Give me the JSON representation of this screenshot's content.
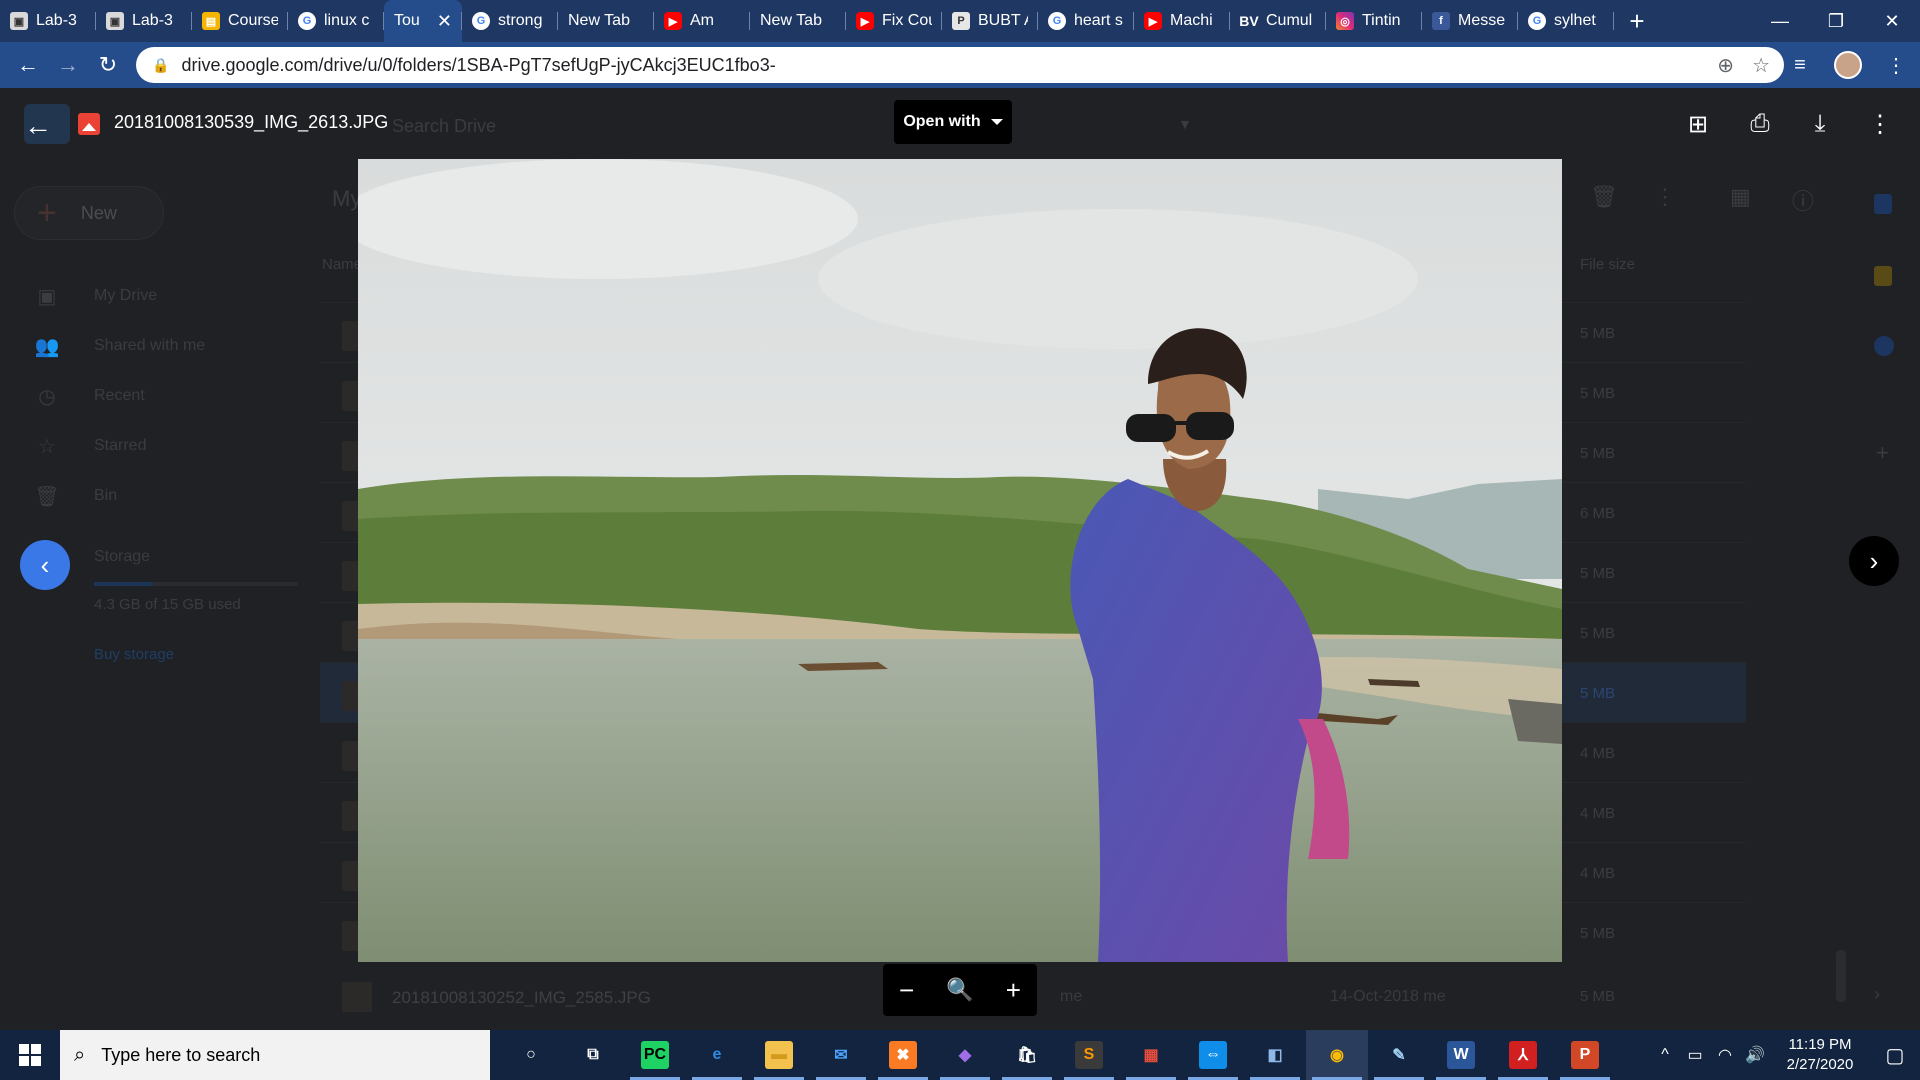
{
  "browser": {
    "tabs": [
      {
        "label": "Lab-3",
        "fav": "doc",
        "favtext": "▣"
      },
      {
        "label": "Lab-3",
        "fav": "doc",
        "favtext": "▣"
      },
      {
        "label": "Course",
        "fav": "slides",
        "favtext": "▤"
      },
      {
        "label": "linux c",
        "fav": "g",
        "favtext": "G"
      },
      {
        "label": "Tou",
        "fav": "drive",
        "favtext": "▲",
        "active": true
      },
      {
        "label": "strong",
        "fav": "g",
        "favtext": "G"
      },
      {
        "label": "New Tab",
        "fav": "",
        "favtext": ""
      },
      {
        "label": "Am",
        "fav": "yt",
        "favtext": "▶"
      },
      {
        "label": "New Tab",
        "fav": "",
        "favtext": ""
      },
      {
        "label": "Fix Cou",
        "fav": "yt",
        "favtext": "▶"
      },
      {
        "label": "BUBT A",
        "fav": "msg",
        "favtext": "P"
      },
      {
        "label": "heart s",
        "fav": "g",
        "favtext": "G"
      },
      {
        "label": "Machi",
        "fav": "yt",
        "favtext": "▶"
      },
      {
        "label": "Cumul",
        "fav": "bv",
        "favtext": "BV"
      },
      {
        "label": "Tintin",
        "fav": "ig",
        "favtext": "◎"
      },
      {
        "label": "Messe",
        "fav": "fb",
        "favtext": "f"
      },
      {
        "label": "sylhet",
        "fav": "g",
        "favtext": "G"
      }
    ],
    "new_tab_glyph": "+",
    "window_controls": [
      "—",
      "❐",
      "✕"
    ],
    "url": "drive.google.com/drive/u/0/folders/1SBA-PgT7sefUgP-jyCAkcj3EUC1fbo3-"
  },
  "drive": {
    "search_placeholder": "Search Drive",
    "new_label": "New",
    "nav": [
      {
        "label": "My Drive",
        "icon": "▣"
      },
      {
        "label": "Shared with me",
        "icon": "👥"
      },
      {
        "label": "Recent",
        "icon": "◷"
      },
      {
        "label": "Starred",
        "icon": "☆"
      },
      {
        "label": "Bin",
        "icon": "🗑"
      }
    ],
    "storage_label": "Storage",
    "storage_used": "4.3 GB of 15 GB used",
    "storage_fraction": 0.29,
    "buy_storage": "Buy storage",
    "heading": "My",
    "col_name": "Name",
    "col_size": "File size",
    "rows": [
      {
        "size": "5 MB"
      },
      {
        "size": "5 MB"
      },
      {
        "size": "5 MB"
      },
      {
        "size": "6 MB"
      },
      {
        "size": "5 MB"
      },
      {
        "size": "5 MB"
      },
      {
        "size": "5 MB",
        "selected": true
      },
      {
        "size": "4 MB"
      },
      {
        "size": "4 MB"
      },
      {
        "size": "4 MB"
      },
      {
        "size": "5 MB"
      }
    ],
    "last_row": {
      "name": "20181008130252_IMG_2585.JPG",
      "owner": "me",
      "modified": "14-Oct-2018 me",
      "size": "5 MB"
    }
  },
  "viewer": {
    "filename": "20181008130539_IMG_2613.JPG",
    "open_with": "Open with",
    "zoom_out": "−",
    "zoom_icon": "🔍",
    "zoom_in": "+"
  },
  "taskbar": {
    "search_placeholder": "Type here to search",
    "time": "11:19 PM",
    "date": "2/27/2020",
    "apps": [
      {
        "name": "cortana",
        "glyph": "○",
        "bg": "transparent",
        "fg": "#ffffff"
      },
      {
        "name": "task-view",
        "glyph": "⧉",
        "bg": "transparent",
        "fg": "#ffffff"
      },
      {
        "name": "pycharm",
        "glyph": "PC",
        "bg": "#1fd264",
        "fg": "#000000"
      },
      {
        "name": "edge",
        "glyph": "e",
        "bg": "transparent",
        "fg": "#2f8ae0"
      },
      {
        "name": "file-explorer",
        "glyph": "▬",
        "bg": "#f2c14e",
        "fg": "#d49a1c"
      },
      {
        "name": "mail",
        "glyph": "✉",
        "bg": "transparent",
        "fg": "#4aa3ff"
      },
      {
        "name": "xampp",
        "glyph": "✖",
        "bg": "#fb7a24",
        "fg": "#ffffff"
      },
      {
        "name": "visual-studio",
        "glyph": "◆",
        "bg": "transparent",
        "fg": "#a26ee8"
      },
      {
        "name": "store",
        "glyph": "🛍",
        "bg": "transparent",
        "fg": "#ffffff"
      },
      {
        "name": "sublime",
        "glyph": "S",
        "bg": "#3a3a3a",
        "fg": "#ff9800"
      },
      {
        "name": "windows-app",
        "glyph": "▦",
        "bg": "transparent",
        "fg": "#e74c3c"
      },
      {
        "name": "teamviewer",
        "glyph": "⇔",
        "bg": "#0e8ee9",
        "fg": "#ffffff"
      },
      {
        "name": "virtualbox",
        "glyph": "◧",
        "bg": "transparent",
        "fg": "#8fb8e8"
      },
      {
        "name": "chrome",
        "glyph": "◉",
        "bg": "transparent",
        "fg": "#fbbc05"
      },
      {
        "name": "notepad",
        "glyph": "✎",
        "bg": "transparent",
        "fg": "#9fd0f0"
      },
      {
        "name": "word",
        "glyph": "W",
        "bg": "#2b579a",
        "fg": "#ffffff"
      },
      {
        "name": "acrobat",
        "glyph": "⅄",
        "bg": "#d21f1f",
        "fg": "#ffffff"
      },
      {
        "name": "powerpoint",
        "glyph": "P",
        "bg": "#d24726",
        "fg": "#ffffff"
      }
    ]
  },
  "colors": {
    "chrome_tabstrip": "#1f3763",
    "chrome_toolbar": "#254d8c",
    "accent_blue": "#3b78e7",
    "drive_bg": "#202124"
  }
}
